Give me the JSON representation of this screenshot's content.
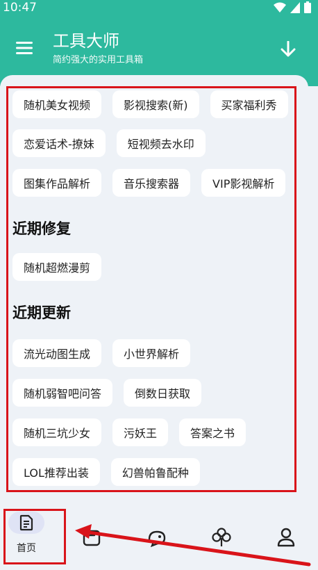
{
  "status_bar": {
    "time": "10:47"
  },
  "header": {
    "title": "工具大师",
    "subtitle": "简约强大的实用工具箱",
    "bg_color": "#2db99e"
  },
  "tools": {
    "row1": [
      "随机美女视频",
      "影视搜索(新)",
      "买家福利秀"
    ],
    "row2": [
      "恋爱话术-撩妹",
      "短视频去水印"
    ],
    "row3": [
      "图集作品解析",
      "音乐搜索器",
      "VIP影视解析"
    ]
  },
  "recent_fixes": {
    "title": "近期修复",
    "items": [
      "随机超燃漫剪"
    ]
  },
  "recent_updates": {
    "title": "近期更新",
    "row1": [
      "流光动图生成",
      "小世界解析"
    ],
    "row2": [
      "随机弱智吧问答",
      "倒数日获取"
    ],
    "row3": [
      "随机三坑少女",
      "污妖王",
      "答案之书"
    ],
    "row4": [
      "LOL推荐出装",
      "幻兽帕鲁配种"
    ]
  },
  "bottom_nav": {
    "home_label": "首页",
    "icons": [
      "home-doc-icon",
      "package-icon",
      "chat-face-icon",
      "clover-icon",
      "user-icon"
    ]
  },
  "annotation_color": "#d9141a"
}
